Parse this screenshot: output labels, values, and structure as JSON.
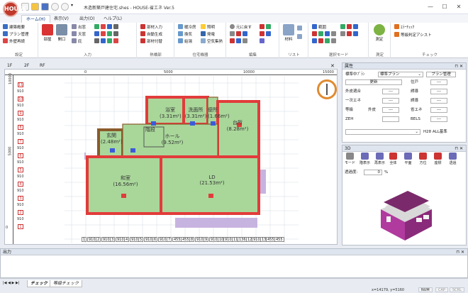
{
  "window": {
    "title": "木造新築戸建住宅.shes - HOUSE-省エネ Ver.5",
    "app_icon": "HOUSE",
    "minimize": "—",
    "maximize": "☐",
    "close": "✕"
  },
  "tabs": [
    "ホーム(H)",
    "表示(V)",
    "出力(O)",
    "ヘルプ(L)"
  ],
  "ribbon": {
    "groups": {
      "settings": {
        "label": "設定",
        "items": [
          "建築概要",
          "プラン管理",
          "外壁再読"
        ]
      },
      "input": {
        "label": "入力",
        "items": [
          "部屋",
          "開口",
          "出窓",
          "天窓",
          "庇"
        ]
      },
      "heat": {
        "label": "熱橋部",
        "items": [
          "部材入力",
          "自動生成",
          "部材付替"
        ]
      },
      "equipment": {
        "label": "住宅機器",
        "items": [
          "暖冷房",
          "換気",
          "給湯",
          "照明",
          "発電",
          "空気集熱"
        ]
      },
      "edit": {
        "label": "編集",
        "items": [
          "元に戻す"
        ]
      },
      "list": {
        "label": "リスト",
        "items": [
          "材料"
        ]
      },
      "select": {
        "label": "選択モード",
        "items": [
          "範囲"
        ]
      },
      "measure": {
        "label": "測定",
        "items": [
          "測定"
        ]
      },
      "check": {
        "label": "チェック",
        "items": [
          "ｴﾗｰﾁｪｯｸ",
          "等級判定アシスト"
        ]
      }
    }
  },
  "floors": [
    "1F",
    "2F",
    "RF"
  ],
  "rulers": {
    "top": [
      "0",
      "5000",
      "10000",
      "15000"
    ],
    "left": [
      "0",
      "5000",
      "10000"
    ]
  },
  "grid_row_labels": [
    "11",
    "910",
    "10",
    "910",
    "9",
    "910",
    "8",
    "910",
    "7",
    "910",
    "6",
    "910",
    "5",
    "910",
    "4",
    "910",
    "3",
    "910",
    "2",
    "910",
    "1"
  ],
  "bottom_dims": [
    "1",
    "910",
    "2",
    "910",
    "3",
    "910",
    "4",
    "910",
    "5",
    "910",
    "6",
    "910",
    "7",
    "455",
    "455",
    "8",
    "910",
    "9",
    "910",
    "10",
    "910",
    "11",
    "1365",
    "12",
    "910",
    "13",
    "455",
    "455"
  ],
  "rooms": [
    {
      "name": "浴室",
      "area": "(3.31m²)"
    },
    {
      "name": "洗面所",
      "area": "(3.31m²)"
    },
    {
      "name": "便所",
      "area": "(1.66m²)"
    },
    {
      "name": "台所",
      "area": "(8.28m²)"
    },
    {
      "name": "玄関",
      "area": "(2.48m²)"
    },
    {
      "name": "階段",
      "area": ""
    },
    {
      "name": "ホール",
      "area": "(9.52m²)"
    },
    {
      "name": "和室",
      "area": "(16.56m²)"
    },
    {
      "name": "LD",
      "area": "(21.53m²)"
    }
  ],
  "properties": {
    "title": "属性",
    "floor_plan_label": "標準中ﾌﾟﾗﾝ",
    "plan_select": "標準プラン",
    "plan_button": "プラン管理",
    "update_button": "更新",
    "rows": [
      {
        "label": "外皮適合",
        "value": "---"
      },
      {
        "label": "一次エネ",
        "value": "---"
      },
      {
        "label": "等級",
        "value": "外皮"
      },
      {
        "label": "ZEH",
        "value": ""
      }
    ],
    "rows_right": [
      {
        "label": "住戸",
        "value": "---"
      },
      {
        "label": "誘導",
        "value": "---"
      },
      {
        "label": "誘導",
        "value": "---"
      },
      {
        "label": "省エネ",
        "value": "---"
      },
      {
        "label": "BELS",
        "value": "---"
      }
    ],
    "standard": "H28 ALL基準"
  },
  "view3d": {
    "title": "3D",
    "tools": [
      "モード",
      "階表示",
      "再表示",
      "全体",
      "平面",
      "方位",
      "座標",
      "透過"
    ],
    "transparency_label": "透過度:",
    "transparency_value": "0",
    "transparency_unit": "%"
  },
  "output": {
    "title": "出力",
    "tabs": [
      "チェック",
      "等級チェック"
    ]
  },
  "status": {
    "coords": "x=14179, y=5160",
    "num": "NUM",
    "cap": "CAP",
    "scrl": "SCRL"
  }
}
